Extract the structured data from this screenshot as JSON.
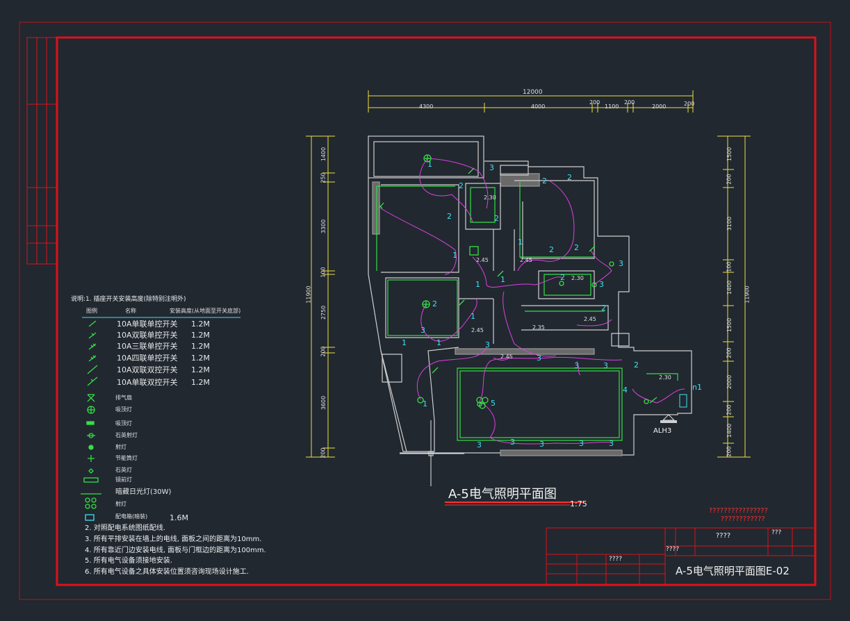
{
  "drawing": {
    "title": "A-5电气照明平面图",
    "scale": "1:75",
    "title_block_name": "A-5电气照明平面图E-02",
    "stamp_line1": "????????????????",
    "stamp_line2": "????????????",
    "tb_q1": "????",
    "tb_q2": "????",
    "tb_q3": "????",
    "tb_q4": "???",
    "panel_label": "ALH3"
  },
  "dimensions": {
    "top_total": "12000",
    "top_segments": [
      "4300",
      "4000",
      "200",
      "1100",
      "200",
      "2000",
      "200"
    ],
    "left_total": "11900",
    "left_segments": [
      "1400",
      "250",
      "3300",
      "100",
      "2750",
      "200",
      "3600",
      "200"
    ],
    "right_total": "11900",
    "right_segments": [
      "1500",
      "200",
      "3100",
      "100",
      "1400",
      "1500",
      "200",
      "2000",
      "200",
      "1400",
      "200"
    ]
  },
  "notes": {
    "note1": "说明:1. 插座开关安装高度(除特别注明外)",
    "col_symbol": "图例",
    "col_name": "名称",
    "col_height": "安装高度(从地面至开关底部)",
    "switches": [
      {
        "name": "10A单联单控开关",
        "height": "1.2M"
      },
      {
        "name": "10A双联单控开关",
        "height": "1.2M"
      },
      {
        "name": "10A三联单控开关",
        "height": "1.2M"
      },
      {
        "name": "10A四联单控开关",
        "height": "1.2M"
      },
      {
        "name": "10A双联双控开关",
        "height": "1.2M"
      },
      {
        "name": "10A单联双控开关",
        "height": "1.2M"
      }
    ],
    "fixtures": [
      "排气扇",
      "吸顶灯",
      "吸顶灯",
      "石英射灯",
      "射灯",
      "节能筒灯",
      "石英灯",
      "镜前灯",
      "暗藏日光灯(30W)",
      "射灯",
      "配电箱(暗装)"
    ],
    "panel_height": "1.6M",
    "note2": "2.  对照配电系统图纸配线.",
    "note3": "3.  所有平排安装在墙上的电线, 面板之间的距离为10mm.",
    "note4": "4.  所有靠近门边安装电线, 面板与门框边的距离为100mm.",
    "note5": "5.  所有电气设备须接地安装.",
    "note6": "6.  所有电气设备之具体安装位置须咨询现场设计施工."
  },
  "plan_labels": {
    "heights": [
      "2.30",
      "2.45",
      "2.45",
      "2.30",
      "2.45",
      "2.35",
      "2.45",
      "2.45",
      "2.30"
    ]
  },
  "colors": {
    "background": "#212830",
    "frame": "#e0101a",
    "wall": "#d8d8d8",
    "circuit": "#e040e0",
    "fixture": "#34e044",
    "dimension": "#f0e040",
    "label": "#41e0f0"
  }
}
